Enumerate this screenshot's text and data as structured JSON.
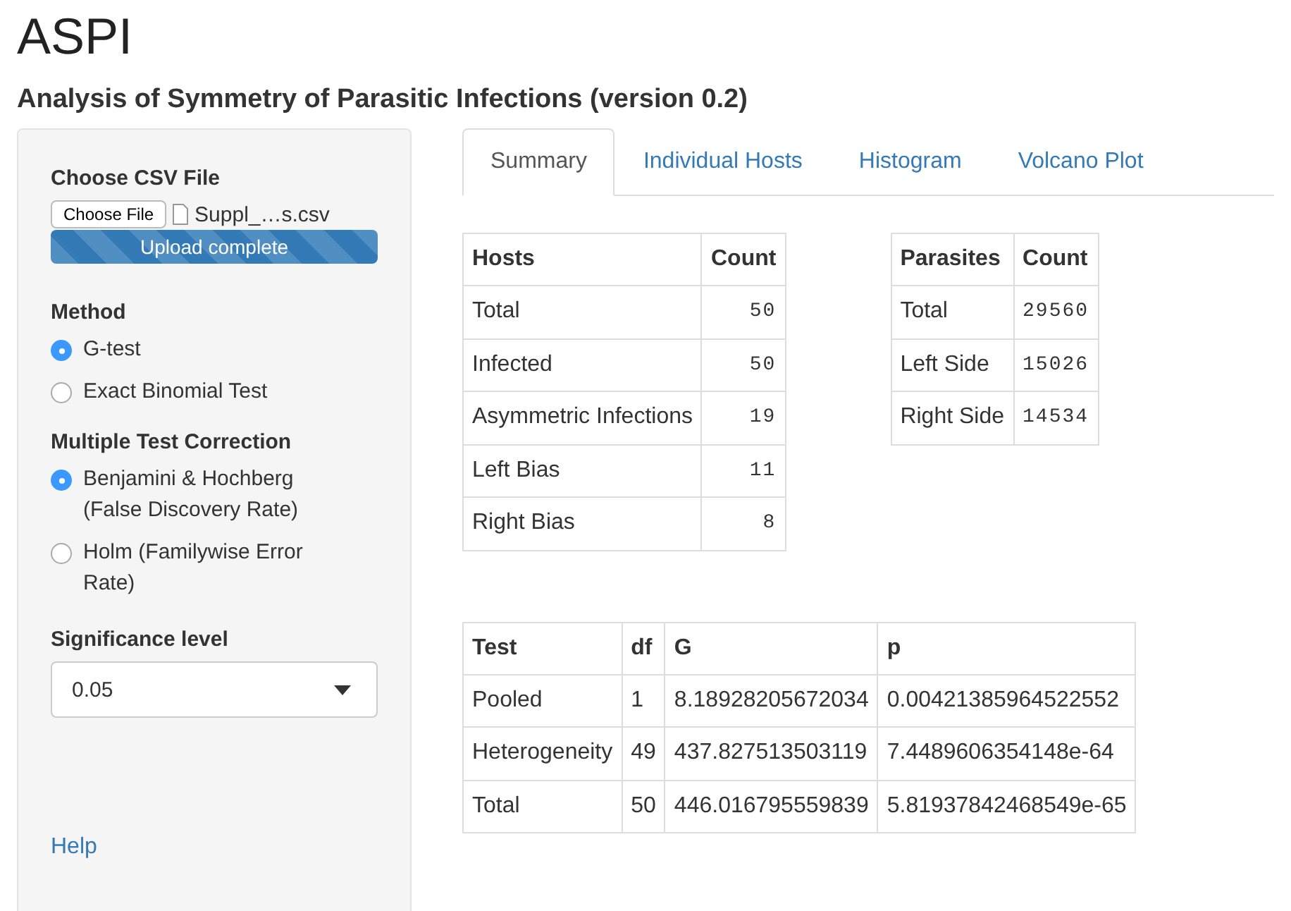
{
  "title": "ASPI",
  "subtitle": "Analysis of Symmetry of Parasitic Infections (version 0.2)",
  "sidebar": {
    "file_input": {
      "label": "Choose CSV File",
      "button": "Choose File",
      "file_name": "Suppl_…s.csv",
      "progress": {
        "text": "Upload complete",
        "level": 1
      }
    },
    "method": {
      "label": "Method",
      "options": [
        {
          "label": "G-test",
          "selected": true
        },
        {
          "label": "Exact Binomial Test",
          "selected": false
        }
      ]
    },
    "correction": {
      "label": "Multiple Test Correction",
      "options": [
        {
          "label": "Benjamini & Hochberg (False Discovery Rate)",
          "selected": true
        },
        {
          "label": "Holm (Familywise Error Rate)",
          "selected": false
        }
      ]
    },
    "significance": {
      "label": "Significance level",
      "value": "0.05"
    },
    "help_link": "Help"
  },
  "tabs": [
    {
      "label": "Summary",
      "selected": true
    },
    {
      "label": "Individual Hosts",
      "selected": false
    },
    {
      "label": "Histogram",
      "selected": false
    },
    {
      "label": "Volcano Plot",
      "selected": false
    }
  ],
  "hosts_table": {
    "columns": [
      "Hosts",
      "Count"
    ],
    "rows": [
      [
        "Total",
        "50"
      ],
      [
        "Infected",
        "50"
      ],
      [
        "Asymmetric Infections",
        "19"
      ],
      [
        "Left Bias",
        "11"
      ],
      [
        "Right Bias",
        "8"
      ]
    ]
  },
  "parasites_table": {
    "columns": [
      "Parasites",
      "Count"
    ],
    "rows": [
      [
        "Total",
        "29560"
      ],
      [
        "Left Side",
        "15026"
      ],
      [
        "Right Side",
        "14534"
      ]
    ]
  },
  "test_table": {
    "columns": [
      "Test",
      "df",
      "G",
      "p"
    ],
    "rows": [
      [
        "Pooled",
        "1",
        "8.18928205672034",
        "0.00421385964522552"
      ],
      [
        "Heterogeneity",
        "49",
        "437.827513503119",
        "7.4489606354148e-64"
      ],
      [
        "Total",
        "50",
        "446.016795559839",
        "5.81937842468549e-65"
      ]
    ]
  }
}
